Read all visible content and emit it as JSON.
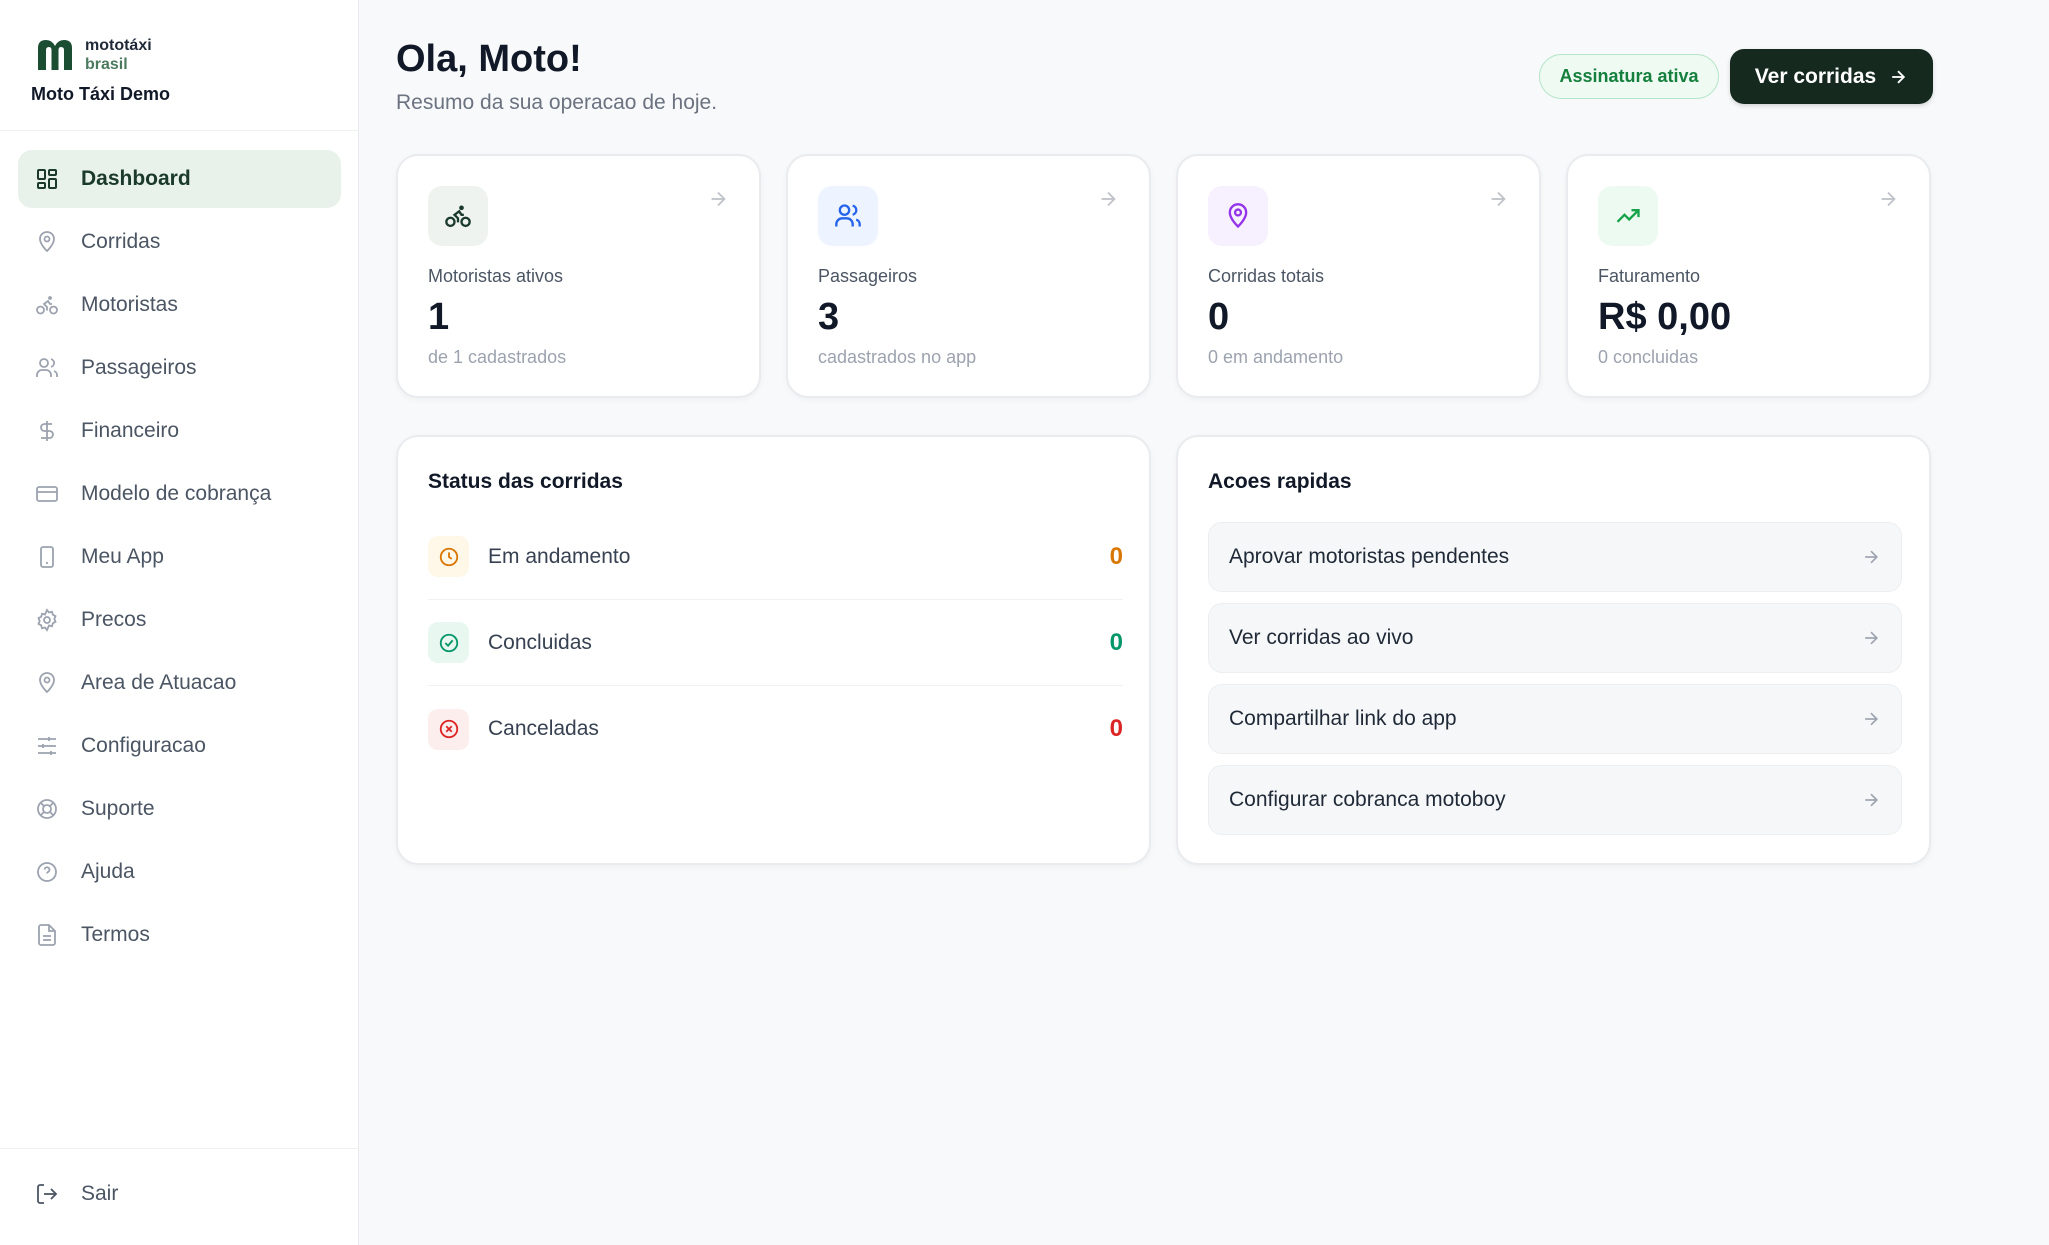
{
  "brand": {
    "logo_line1": "mototáxi",
    "logo_line2": "brasil",
    "company": "Moto Táxi Demo"
  },
  "sidebar": {
    "items": [
      {
        "label": "Dashboard",
        "icon": "dashboard-icon",
        "active": true
      },
      {
        "label": "Corridas",
        "icon": "map-pin-icon"
      },
      {
        "label": "Motoristas",
        "icon": "bike-icon"
      },
      {
        "label": "Passageiros",
        "icon": "users-icon"
      },
      {
        "label": "Financeiro",
        "icon": "dollar-icon"
      },
      {
        "label": "Modelo de cobrança",
        "icon": "credit-card-icon"
      },
      {
        "label": "Meu App",
        "icon": "smartphone-icon"
      },
      {
        "label": "Precos",
        "icon": "gear-icon"
      },
      {
        "label": "Area de Atuacao",
        "icon": "map-pin-icon"
      },
      {
        "label": "Configuracao",
        "icon": "sliders-icon"
      },
      {
        "label": "Suporte",
        "icon": "lifebuoy-icon"
      },
      {
        "label": "Ajuda",
        "icon": "help-circle-icon"
      },
      {
        "label": "Termos",
        "icon": "file-text-icon"
      }
    ],
    "logout": "Sair"
  },
  "header": {
    "greeting": "Ola, Moto!",
    "subtitle": "Resumo da sua operacao de hoje.",
    "badge": "Assinatura ativa",
    "cta": "Ver corridas"
  },
  "stats": [
    {
      "label": "Motoristas ativos",
      "value": "1",
      "sub": "de 1 cadastrados",
      "icon": "bike-icon",
      "color": "#1b3a2c",
      "bg": "#eef3ef"
    },
    {
      "label": "Passageiros",
      "value": "3",
      "sub": "cadastrados no app",
      "icon": "users-icon",
      "color": "#2563eb",
      "bg": "#eef4ff"
    },
    {
      "label": "Corridas totais",
      "value": "0",
      "sub": "0 em andamento",
      "icon": "map-pin-icon",
      "color": "#9333ea",
      "bg": "#f7f0ff"
    },
    {
      "label": "Faturamento",
      "value": "R$ 0,00",
      "sub": "0 concluidas",
      "icon": "trending-up-icon",
      "color": "#16a34a",
      "bg": "#edfaf2"
    }
  ],
  "status_panel": {
    "title": "Status das corridas",
    "rows": [
      {
        "label": "Em andamento",
        "count": "0",
        "color": "#d97706",
        "bg": "#fff7e8",
        "icon": "clock-icon"
      },
      {
        "label": "Concluidas",
        "count": "0",
        "color": "#059669",
        "bg": "#e8f8f0",
        "icon": "check-circle-icon"
      },
      {
        "label": "Canceladas",
        "count": "0",
        "color": "#dc2626",
        "bg": "#fdeeee",
        "icon": "x-circle-icon"
      }
    ]
  },
  "actions_panel": {
    "title": "Acoes rapidas",
    "items": [
      "Aprovar motoristas pendentes",
      "Ver corridas ao vivo",
      "Compartilhar link do app",
      "Configurar cobranca motoboy"
    ]
  }
}
